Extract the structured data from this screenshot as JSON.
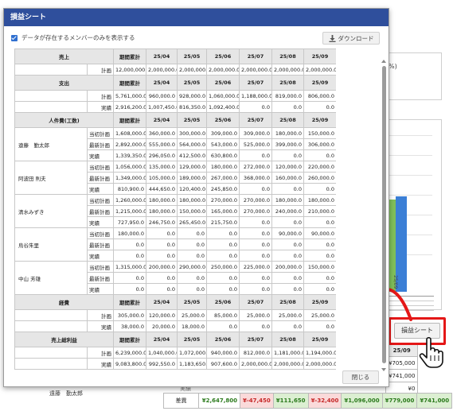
{
  "modal": {
    "title": "損益シート",
    "filter_label": "データが存在するメンバーのみを表示する",
    "download_label": "ダウンロード",
    "close_label": "閉じる"
  },
  "columns": [
    "期間累計",
    "25/04",
    "25/05",
    "25/06",
    "25/07",
    "25/08",
    "25/09"
  ],
  "sections": [
    {
      "title": "売上",
      "rows": [
        {
          "label": "計画",
          "values": [
            "12,000,000.0",
            "2,000,000.0",
            "2,000,000.0",
            "2,000,000.0",
            "2,000,000.0",
            "2,000,000.0",
            "2,000,000.0"
          ]
        }
      ]
    },
    {
      "title": "支出",
      "rows": [
        {
          "label": "計画",
          "values": [
            "5,761,000.0",
            "960,000.0",
            "928,000.0",
            "1,060,000.0",
            "1,188,000.0",
            "819,000.0",
            "806,000.0"
          ]
        },
        {
          "label": "実績",
          "values": [
            "2,916,200.0",
            "1,007,450.0",
            "816,350.0",
            "1,092,400.0",
            "0.0",
            "0.0",
            "0.0"
          ]
        }
      ]
    },
    {
      "title": "人件費(工数)",
      "members": [
        {
          "name": "遠藤　勤太郎",
          "rows": [
            {
              "label": "当初計画",
              "values": [
                "1,608,000.0",
                "360,000.0",
                "300,000.0",
                "309,000.0",
                "309,000.0",
                "180,000.0",
                "150,000.0"
              ]
            },
            {
              "label": "最新計画",
              "values": [
                "2,892,000.0",
                "555,000.0",
                "564,000.0",
                "543,000.0",
                "525,000.0",
                "399,000.0",
                "306,000.0"
              ]
            },
            {
              "label": "実績",
              "values": [
                "1,339,350.0",
                "296,050.0",
                "412,500.0",
                "630,800.0",
                "0.0",
                "0.0",
                "0.0"
              ]
            }
          ]
        },
        {
          "name": "阿波田 則夫",
          "rows": [
            {
              "label": "当初計画",
              "values": [
                "1,056,000.0",
                "135,000.0",
                "129,000.0",
                "180,000.0",
                "272,000.0",
                "120,000.0",
                "220,000.0"
              ]
            },
            {
              "label": "最新計画",
              "values": [
                "1,349,000.0",
                "105,000.0",
                "189,000.0",
                "267,000.0",
                "368,000.0",
                "160,000.0",
                "260,000.0"
              ]
            },
            {
              "label": "実績",
              "values": [
                "810,900.0",
                "444,650.0",
                "120,400.0",
                "245,850.0",
                "0.0",
                "0.0",
                "0.0"
              ]
            }
          ]
        },
        {
          "name": "清水みずき",
          "rows": [
            {
              "label": "当初計画",
              "values": [
                "1,260,000.0",
                "180,000.0",
                "180,000.0",
                "270,000.0",
                "270,000.0",
                "180,000.0",
                "180,000.0"
              ]
            },
            {
              "label": "最新計画",
              "values": [
                "1,215,000.0",
                "180,000.0",
                "150,000.0",
                "165,000.0",
                "270,000.0",
                "240,000.0",
                "210,000.0"
              ]
            },
            {
              "label": "実績",
              "values": [
                "727,950.0",
                "246,750.0",
                "265,450.0",
                "215,750.0",
                "0.0",
                "0.0",
                "0.0"
              ]
            }
          ]
        },
        {
          "name": "烏谷朱里",
          "rows": [
            {
              "label": "当初計画",
              "values": [
                "180,000.0",
                "0.0",
                "0.0",
                "0.0",
                "0.0",
                "90,000.0",
                "90,000.0"
              ]
            },
            {
              "label": "最新計画",
              "values": [
                "0.0",
                "0.0",
                "0.0",
                "0.0",
                "0.0",
                "0.0",
                "0.0"
              ]
            },
            {
              "label": "実績",
              "values": [
                "0.0",
                "0.0",
                "0.0",
                "0.0",
                "0.0",
                "0.0",
                "0.0"
              ]
            }
          ]
        },
        {
          "name": "中山 芳雄",
          "rows": [
            {
              "label": "当初計画",
              "values": [
                "1,315,000.0",
                "200,000.0",
                "290,000.0",
                "250,000.0",
                "225,000.0",
                "200,000.0",
                "150,000.0"
              ]
            },
            {
              "label": "最新計画",
              "values": [
                "0.0",
                "0.0",
                "0.0",
                "0.0",
                "0.0",
                "0.0",
                "0.0"
              ]
            },
            {
              "label": "実績",
              "values": [
                "0.0",
                "0.0",
                "0.0",
                "0.0",
                "0.0",
                "0.0",
                "0.0"
              ]
            }
          ]
        }
      ]
    },
    {
      "title": "経費",
      "rows": [
        {
          "label": "計画",
          "values": [
            "305,000.0",
            "120,000.0",
            "25,000.0",
            "85,000.0",
            "25,000.0",
            "25,000.0",
            "25,000.0"
          ]
        },
        {
          "label": "実績",
          "values": [
            "38,000.0",
            "20,000.0",
            "18,000.0",
            "0.0",
            "0.0",
            "0.0",
            "0.0"
          ]
        }
      ]
    },
    {
      "title": "売上総利益",
      "rows": [
        {
          "label": "計画",
          "values": [
            "6,239,000.0",
            "1,040,000.0",
            "1,072,000.0",
            "940,000.0",
            "812,000.0",
            "1,181,000.0",
            "1,194,000.0"
          ]
        },
        {
          "label": "実績",
          "values": [
            "9,083,800.0",
            "992,550.0",
            "1,183,650.0",
            "907,600.0",
            "2,000,000.0",
            "2,000,000.0",
            "2,000,000.0"
          ]
        }
      ]
    }
  ],
  "background": {
    "panel_text": "%)",
    "chart_label": "25/09",
    "sheet_button_label": "損益シート",
    "right_column": {
      "header": "25/09",
      "values": [
        "¥705,000",
        "¥741,000",
        "¥0",
        "¥741,000"
      ]
    },
    "member_name": "遠藤　勤太郎",
    "jisseki_label": "実績",
    "diff_label": "差異",
    "diff_total": "¥2,647,800",
    "diff_values": [
      "¥-47,450",
      "¥111,650",
      "¥-32,400",
      "¥1,096,000",
      "¥779,000",
      "¥741,000"
    ],
    "colors": {
      "bar_green": "#7fbf5a",
      "bar_blue": "#3b7fd6",
      "accent_red": "#e41717",
      "title_blue": "#2f4f9c"
    }
  }
}
